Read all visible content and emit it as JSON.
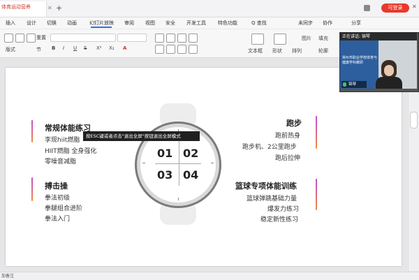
{
  "titlebar": {
    "doc_tab": "体育运动营养",
    "new_tab": "+",
    "login_label": "可登录"
  },
  "menu": {
    "items": [
      "插入",
      "设计",
      "切换",
      "动画",
      "幻灯片放映",
      "审阅",
      "视图",
      "安全",
      "开发工具",
      "特色功能",
      "Q 查找"
    ],
    "right": [
      "未同步",
      "协作",
      "分享"
    ]
  },
  "toolbar": {
    "new_label": "重置",
    "format_label": "版式",
    "sections_label": "节",
    "textbox_label": "文本框",
    "shape_label": "形状",
    "arrange_label": "排列",
    "picture_label": "图片",
    "fill_label": "填充",
    "outline_label": "轮廓"
  },
  "slide": {
    "left_top": {
      "title": "常规体能练习",
      "items": [
        "李现hiit燃脂",
        "HIIT燃脂 全身强化",
        "零噪音减脂"
      ]
    },
    "left_bottom": {
      "title": "搏击操",
      "items": [
        "拳法初级",
        "拳腿组合进阶",
        "拳法入门"
      ]
    },
    "right_top": {
      "title": "跑步",
      "items": [
        "跑前热身",
        "跑步机、2公里跑步",
        "跑后拉伸"
      ]
    },
    "right_bottom": {
      "title": "篮球专项体能训练",
      "items": [
        "篮球弹跳基础力量",
        "爆发力练习",
        "稳定新性练习"
      ]
    },
    "watch_numbers": [
      "01",
      "02",
      "03",
      "04"
    ],
    "tooltip": "按ESC键或者点击\"退出全屏\"按钮退出全屏模式"
  },
  "statusbar": {
    "text": "加备注"
  },
  "video": {
    "header": "正在讲话: 锦琴",
    "screen_text": "常州市职业学校体育与健康学科教研",
    "name": "锦琴"
  },
  "colors": {
    "accent": "#2f6fe4",
    "login": "#e8392b",
    "bar_top": "#c44bd8",
    "bar_bottom": "#f08b3a"
  }
}
